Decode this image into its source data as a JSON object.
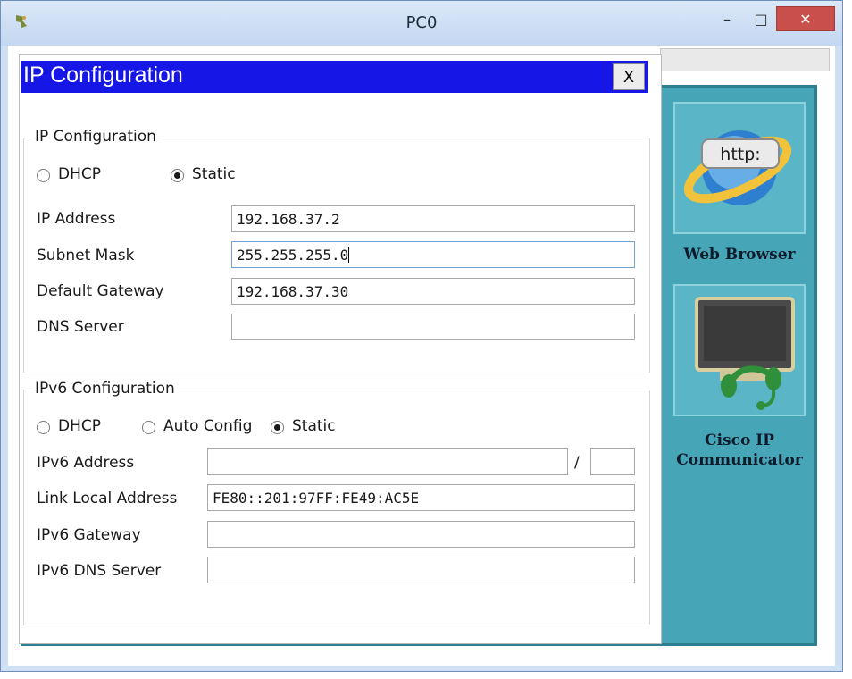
{
  "window": {
    "title": "PC0",
    "minimize_glyph": "–",
    "maximize_glyph": "□",
    "close_glyph": "✕"
  },
  "dialog": {
    "title": "IP Configuration",
    "close_label": "X"
  },
  "ipv4": {
    "legend": "IP Configuration",
    "dhcp_label": "DHCP",
    "static_label": "Static",
    "selected": "Static",
    "ip_address_label": "IP Address",
    "ip_address": "192.168.37.2",
    "subnet_mask_label": "Subnet Mask",
    "subnet_mask": "255.255.255.0",
    "default_gateway_label": "Default Gateway",
    "default_gateway": "192.168.37.30",
    "dns_server_label": "DNS Server",
    "dns_server": ""
  },
  "ipv6": {
    "legend": "IPv6 Configuration",
    "dhcp_label": "DHCP",
    "auto_config_label": "Auto Config",
    "static_label": "Static",
    "selected": "Static",
    "address_label": "IPv6 Address",
    "address": "",
    "prefix_separator": "/",
    "prefix": "",
    "link_local_label": "Link Local Address",
    "link_local": "FE80::201:97FF:FE49:AC5E",
    "gateway_label": "IPv6 Gateway",
    "gateway": "",
    "dns_label": "IPv6 DNS Server",
    "dns": ""
  },
  "apps": [
    {
      "label": "Web Browser",
      "icon": "web-browser-icon",
      "icon_text": "http:"
    },
    {
      "label": "Cisco IP Communicator",
      "icon": "ip-communicator-icon"
    }
  ],
  "colors": {
    "dialog_title_bg": "#1616e6",
    "desktop_bg": "#46a6b8",
    "close_button_bg": "#c9504a"
  }
}
